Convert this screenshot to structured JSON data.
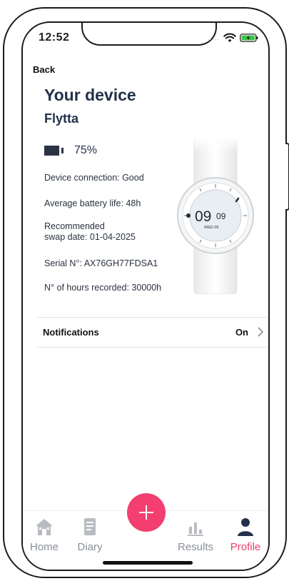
{
  "status_bar": {
    "time": "12:52",
    "signal": "....."
  },
  "nav": {
    "back_label": "Back"
  },
  "header": {
    "title": "Your device",
    "device_name": "Flytta"
  },
  "battery": {
    "percent_text": "75%",
    "level": 0.75
  },
  "device_info": {
    "connection": "Device connection: Good",
    "battery_life": "Average battery life: 48h",
    "swap_line1": "Recommended",
    "swap_line2": "swap date: 01-04-2025",
    "serial": "Serial N°: AX76GH77FDSA1",
    "hours": "N° of hours recorded: 30000h"
  },
  "watch": {
    "time_hours": "09",
    "time_minutes": "09",
    "date": "WED 09"
  },
  "settings": {
    "notifications_label": "Notifications",
    "notifications_value": "On"
  },
  "tabs": [
    {
      "label": "Home",
      "icon": "home-icon",
      "active": false
    },
    {
      "label": "Diary",
      "icon": "diary-icon",
      "active": false
    },
    {
      "label": "Results",
      "icon": "results-icon",
      "active": false
    },
    {
      "label": "Profile",
      "icon": "profile-icon",
      "active": true
    }
  ],
  "colors": {
    "accent": "#f23f6f",
    "title": "#23324a",
    "inactive_tab": "#8a8f98"
  }
}
